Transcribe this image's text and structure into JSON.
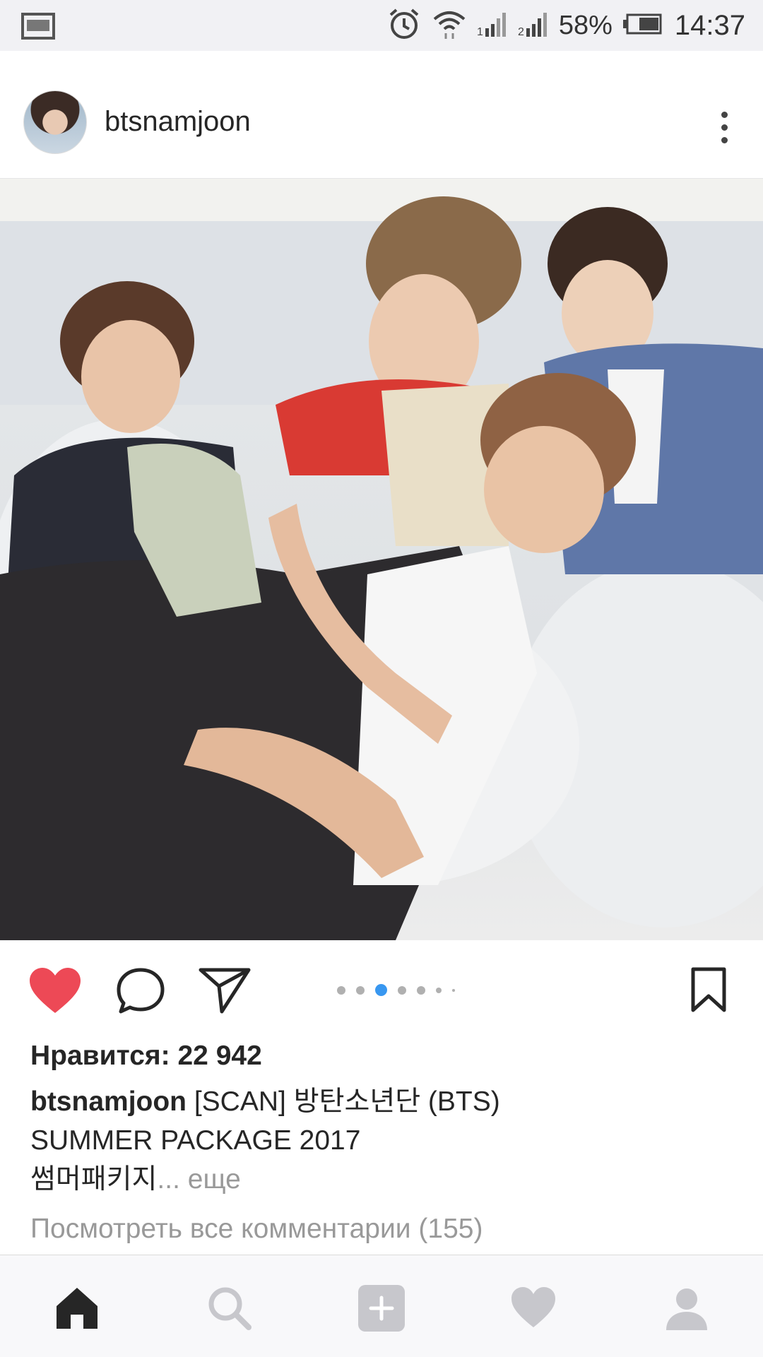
{
  "status_bar": {
    "battery_percent": "58%",
    "time": "14:37",
    "icons": [
      "image-notification-icon",
      "alarm-icon",
      "wifi-icon",
      "signal-1-icon",
      "signal-2-icon",
      "battery-icon"
    ]
  },
  "post": {
    "username": "btsnamjoon",
    "image_alt": "Group photo of four people lying on white pillows",
    "carousel": {
      "total": 7,
      "active_index": 2
    },
    "likes_text": "Нравится: 22 942",
    "caption": {
      "user": "btsnamjoon",
      "line1": " [SCAN] 방탄소년단 (BTS)",
      "line2": " SUMMER PACKAGE 2017",
      "line3": "썸머패키지",
      "more_label": "... еще"
    },
    "view_comments": "Посмотреть все комментарии (155)"
  },
  "colors": {
    "like_red": "#ed4956",
    "carousel_active": "#3897f0",
    "nav_inactive": "#c7c7cc",
    "nav_active": "#262626"
  },
  "bottom_nav": [
    "home-icon",
    "search-icon",
    "add-post-icon",
    "activity-heart-icon",
    "profile-icon"
  ]
}
